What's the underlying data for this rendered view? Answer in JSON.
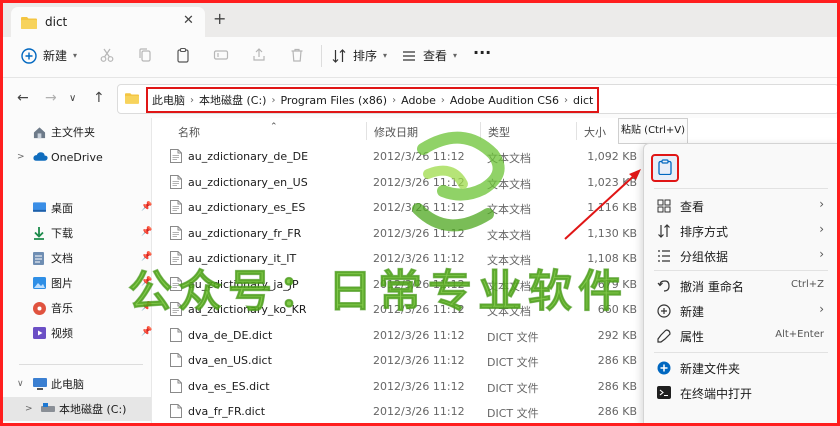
{
  "window": {
    "tab_title": "dict",
    "close_glyph": "✕",
    "new_tab_glyph": "+"
  },
  "toolbar": {
    "new_label": "新建",
    "sort_label": "排序",
    "view_label": "查看",
    "more_glyph": "···"
  },
  "breadcrumb": [
    "此电脑",
    "本地磁盘 (C:)",
    "Program Files (x86)",
    "Adobe",
    "Adobe Audition CS6",
    "dict"
  ],
  "sidebar": {
    "items": [
      {
        "label": "主文件夹",
        "icon": "home-icon"
      },
      {
        "label": "OneDrive",
        "icon": "cloud-icon"
      },
      {
        "label": "桌面",
        "icon": "desktop-icon"
      },
      {
        "label": "下载",
        "icon": "download-icon"
      },
      {
        "label": "文档",
        "icon": "document-icon"
      },
      {
        "label": "图片",
        "icon": "picture-icon"
      },
      {
        "label": "音乐",
        "icon": "music-icon"
      },
      {
        "label": "视频",
        "icon": "video-icon"
      },
      {
        "label": "此电脑",
        "icon": "computer-icon"
      },
      {
        "label": "本地磁盘 (C:)",
        "icon": "drive-icon"
      }
    ]
  },
  "columns": {
    "name": "名称",
    "modified": "修改日期",
    "type": "类型",
    "size": "大小"
  },
  "files": [
    {
      "name": "au_zdictionary_de_DE",
      "date": "2012/3/26 11:12",
      "type": "文本文档",
      "size": "1,092 KB"
    },
    {
      "name": "au_zdictionary_en_US",
      "date": "2012/3/26 11:12",
      "type": "文本文档",
      "size": "1,023 KB"
    },
    {
      "name": "au_zdictionary_es_ES",
      "date": "2012/3/26 11:12",
      "type": "文本文档",
      "size": "1,116 KB"
    },
    {
      "name": "au_zdictionary_fr_FR",
      "date": "2012/3/26 11:12",
      "type": "文本文档",
      "size": "1,130 KB"
    },
    {
      "name": "au_zdictionary_it_IT",
      "date": "2012/3/26 11:12",
      "type": "文本文档",
      "size": "1,108 KB"
    },
    {
      "name": "au_zdictionary_ja_JP",
      "date": "2012/3/26 11:12",
      "type": "文本文档",
      "size": "679 KB"
    },
    {
      "name": "au_zdictionary_ko_KR",
      "date": "2012/3/26 11:12",
      "type": "文本文档",
      "size": "660 KB"
    },
    {
      "name": "dva_de_DE.dict",
      "date": "2012/3/26 11:12",
      "type": "DICT 文件",
      "size": "292 KB"
    },
    {
      "name": "dva_en_US.dict",
      "date": "2012/3/26 11:12",
      "type": "DICT 文件",
      "size": "286 KB"
    },
    {
      "name": "dva_es_ES.dict",
      "date": "2012/3/26 11:12",
      "type": "DICT 文件",
      "size": "286 KB"
    },
    {
      "name": "dva_fr_FR.dict",
      "date": "2012/3/26 11:12",
      "type": "DICT 文件",
      "size": "286 KB"
    }
  ],
  "context_menu": {
    "tooltip": "粘贴 (Ctrl+V)",
    "items": [
      {
        "label": "查看",
        "shortcut": "",
        "has_submenu": true
      },
      {
        "label": "排序方式",
        "shortcut": "",
        "has_submenu": true
      },
      {
        "label": "分组依据",
        "shortcut": "",
        "has_submenu": true
      },
      {
        "label": "撤消 重命名",
        "shortcut": "Ctrl+Z",
        "has_submenu": false
      },
      {
        "label": "新建",
        "shortcut": "",
        "has_submenu": true
      },
      {
        "label": "属性",
        "shortcut": "Alt+Enter",
        "has_submenu": false
      },
      {
        "label": "新建文件夹",
        "shortcut": "",
        "has_submenu": false
      },
      {
        "label": "在终端中打开",
        "shortcut": "",
        "has_submenu": false
      }
    ]
  },
  "watermark": {
    "text": "公众号：日常专业软件"
  },
  "colors": {
    "frame_red": "#ff1e1e",
    "highlight_red": "#e01616",
    "folder_yellow": "#f4c542",
    "accent_blue": "#0067c0",
    "watermark_green": "#68be24"
  }
}
